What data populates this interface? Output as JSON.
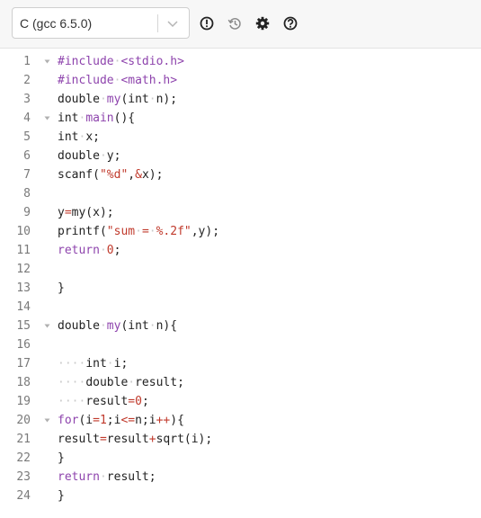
{
  "toolbar": {
    "language": "C (gcc 6.5.0)",
    "icons": [
      {
        "name": "info-icon",
        "glyph": "!"
      },
      {
        "name": "history-icon",
        "glyph": "history"
      },
      {
        "name": "gear-icon",
        "glyph": "gear"
      },
      {
        "name": "help-icon",
        "glyph": "?"
      }
    ]
  },
  "editor": {
    "lines": [
      {
        "n": "1",
        "fold": true,
        "tokens": [
          [
            "pre",
            "#include"
          ],
          [
            "ws",
            "·"
          ],
          [
            "inc",
            "<stdio.h>"
          ]
        ]
      },
      {
        "n": "2",
        "fold": false,
        "tokens": [
          [
            "pre",
            "#include"
          ],
          [
            "ws",
            "·"
          ],
          [
            "inc",
            "<math.h>"
          ]
        ]
      },
      {
        "n": "3",
        "fold": false,
        "tokens": [
          [
            "",
            "double"
          ],
          [
            "ws",
            "·"
          ],
          [
            "fn",
            "my"
          ],
          [
            "",
            "(int"
          ],
          [
            "ws",
            "·"
          ],
          [
            "",
            "n);"
          ]
        ]
      },
      {
        "n": "4",
        "fold": true,
        "tokens": [
          [
            "",
            "int"
          ],
          [
            "ws",
            "·"
          ],
          [
            "fn",
            "main"
          ],
          [
            "",
            "(){"
          ]
        ]
      },
      {
        "n": "5",
        "fold": false,
        "tokens": [
          [
            "",
            "int"
          ],
          [
            "ws",
            "·"
          ],
          [
            "",
            "x;"
          ]
        ]
      },
      {
        "n": "6",
        "fold": false,
        "tokens": [
          [
            "",
            "double"
          ],
          [
            "ws",
            "·"
          ],
          [
            "",
            "y;"
          ]
        ]
      },
      {
        "n": "7",
        "fold": false,
        "tokens": [
          [
            "",
            "scanf("
          ],
          [
            "str",
            "\"%d\""
          ],
          [
            "",
            ","
          ],
          [
            "op",
            "&"
          ],
          [
            "",
            "x);"
          ]
        ]
      },
      {
        "n": "8",
        "fold": false,
        "tokens": []
      },
      {
        "n": "9",
        "fold": false,
        "tokens": [
          [
            "",
            "y"
          ],
          [
            "op",
            "="
          ],
          [
            "",
            "my(x);"
          ]
        ]
      },
      {
        "n": "10",
        "fold": false,
        "tokens": [
          [
            "",
            "printf("
          ],
          [
            "str",
            "\"sum"
          ],
          [
            "ws",
            "·"
          ],
          [
            "str",
            "="
          ],
          [
            "ws",
            "·"
          ],
          [
            "str",
            "%.2f\""
          ],
          [
            "",
            ",y);"
          ]
        ]
      },
      {
        "n": "11",
        "fold": false,
        "tokens": [
          [
            "kw",
            "return"
          ],
          [
            "ws",
            "·"
          ],
          [
            "num",
            "0"
          ],
          [
            "",
            ";"
          ]
        ]
      },
      {
        "n": "12",
        "fold": false,
        "tokens": []
      },
      {
        "n": "13",
        "fold": false,
        "tokens": [
          [
            "",
            "}"
          ]
        ]
      },
      {
        "n": "14",
        "fold": false,
        "tokens": []
      },
      {
        "n": "15",
        "fold": true,
        "tokens": [
          [
            "",
            "double"
          ],
          [
            "ws",
            "·"
          ],
          [
            "fn",
            "my"
          ],
          [
            "",
            "(int"
          ],
          [
            "ws",
            "·"
          ],
          [
            "",
            "n){"
          ]
        ]
      },
      {
        "n": "16",
        "fold": false,
        "tokens": []
      },
      {
        "n": "17",
        "fold": false,
        "tokens": [
          [
            "ws",
            "····"
          ],
          [
            "",
            "int"
          ],
          [
            "ws",
            "·"
          ],
          [
            "",
            "i;"
          ]
        ]
      },
      {
        "n": "18",
        "fold": false,
        "tokens": [
          [
            "ws",
            "····"
          ],
          [
            "",
            "double"
          ],
          [
            "ws",
            "·"
          ],
          [
            "",
            "result;"
          ]
        ]
      },
      {
        "n": "19",
        "fold": false,
        "tokens": [
          [
            "ws",
            "····"
          ],
          [
            "",
            "result"
          ],
          [
            "op",
            "="
          ],
          [
            "num",
            "0"
          ],
          [
            "",
            ";"
          ]
        ]
      },
      {
        "n": "20",
        "fold": true,
        "tokens": [
          [
            "kw",
            "for"
          ],
          [
            "",
            "(i"
          ],
          [
            "op",
            "="
          ],
          [
            "num",
            "1"
          ],
          [
            "",
            ";i"
          ],
          [
            "op",
            "<="
          ],
          [
            "",
            "n;i"
          ],
          [
            "op",
            "++"
          ],
          [
            "",
            "){"
          ]
        ]
      },
      {
        "n": "21",
        "fold": false,
        "tokens": [
          [
            "",
            "result"
          ],
          [
            "op",
            "="
          ],
          [
            "",
            "result"
          ],
          [
            "op",
            "+"
          ],
          [
            "",
            "sqrt(i);"
          ]
        ]
      },
      {
        "n": "22",
        "fold": false,
        "tokens": [
          [
            "",
            "}"
          ]
        ]
      },
      {
        "n": "23",
        "fold": false,
        "tokens": [
          [
            "kw",
            "return"
          ],
          [
            "ws",
            "·"
          ],
          [
            "",
            "result;"
          ]
        ]
      },
      {
        "n": "24",
        "fold": false,
        "tokens": [
          [
            "",
            "}"
          ]
        ]
      }
    ]
  }
}
